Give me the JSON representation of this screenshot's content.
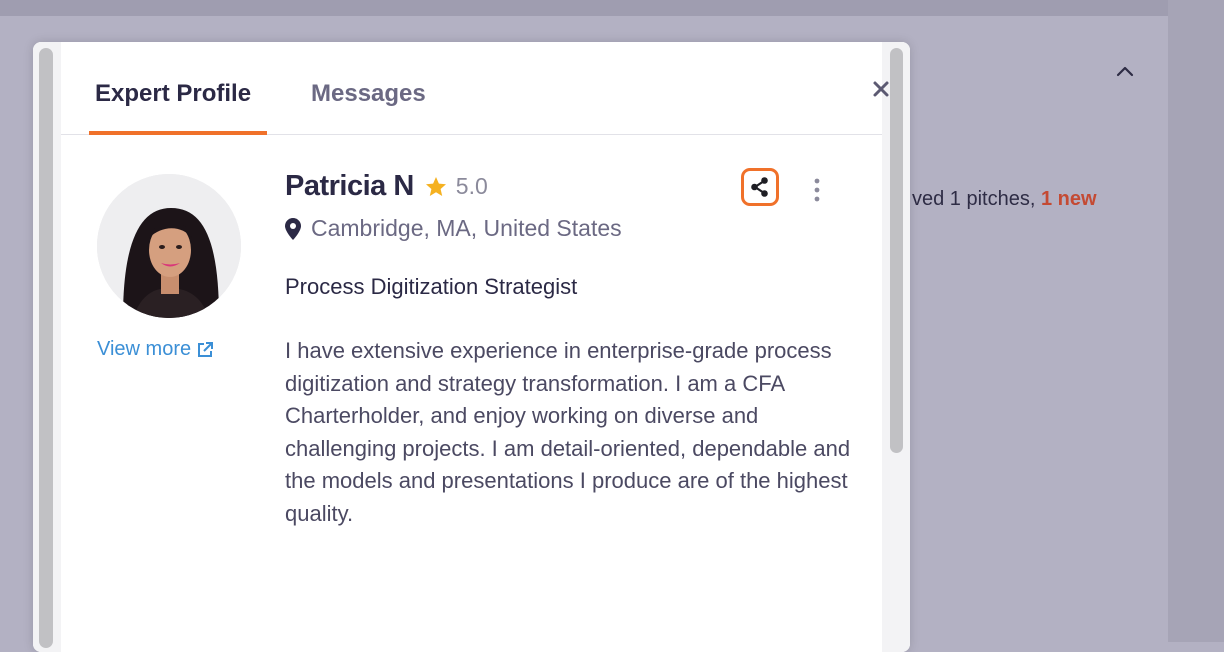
{
  "background": {
    "pitches_text": "ved 1 pitches, ",
    "new_badge": "1 new",
    "chevron_icon": "chevron-up"
  },
  "tabs": [
    {
      "label": "Expert Profile",
      "active": true
    },
    {
      "label": "Messages",
      "active": false
    }
  ],
  "profile": {
    "name": "Patricia N",
    "rating": "5.0",
    "location": "Cambridge, MA, United States",
    "headline": "Process Digitization Strategist",
    "view_more": "View more",
    "bio": "I have extensive experience in enterprise-grade process digitization and strategy transformation. I am a CFA Charterholder, and enjoy working on diverse and challenging projects. I am detail-oriented, dependable and the models and presentations I produce are of the highest quality."
  },
  "colors": {
    "accent": "#f0712a",
    "link": "#3b8fd6",
    "star": "#f5b120",
    "new_badge": "#c44a33",
    "text_primary": "#2b2945"
  },
  "icons": [
    "close-icon",
    "share-icon",
    "more-vertical-icon",
    "star-icon",
    "location-pin-icon",
    "external-link-icon",
    "chevron-up-icon"
  ]
}
